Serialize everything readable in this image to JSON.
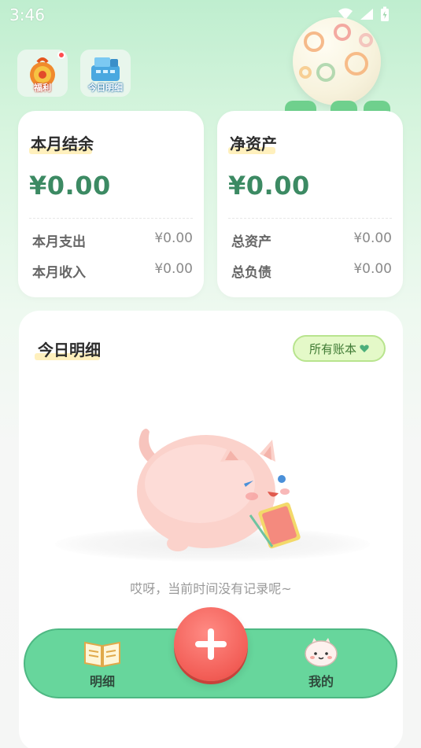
{
  "status_bar": {
    "time": "3:46"
  },
  "top_buttons": {
    "welfare_label": "福利",
    "today_detail_label": "今日明细"
  },
  "summary": {
    "month": {
      "title": "本月结余",
      "amount": "¥0.00",
      "rows": [
        {
          "label": "本月支出",
          "value": "¥0.00"
        },
        {
          "label": "本月收入",
          "value": "¥0.00"
        }
      ]
    },
    "net_assets": {
      "title": "净资产",
      "amount": "¥0.00",
      "rows": [
        {
          "label": "总资产",
          "value": "¥0.00"
        },
        {
          "label": "总负债",
          "value": "¥0.00"
        }
      ]
    }
  },
  "today": {
    "title": "今日明细",
    "account_filter": "所有账本",
    "empty_text": "哎呀，当前时间没有记录呢~"
  },
  "bottom_nav": {
    "items": [
      {
        "label": "明细",
        "icon": "open-book-icon"
      },
      {
        "label": "我的",
        "icon": "mascot-face-icon"
      }
    ],
    "add_icon": "plus-icon"
  },
  "colors": {
    "accent_green": "#3c8a63",
    "nav_green": "#67d69c",
    "add_red": "#f25d56",
    "highlight_yellow": "#fff0bd",
    "filter_bg": "#e4f9c8"
  }
}
